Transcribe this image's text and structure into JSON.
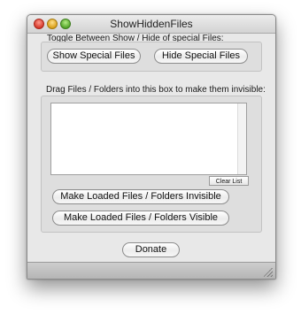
{
  "window": {
    "title": "ShowHiddenFiles"
  },
  "toggle_section": {
    "label": "Toggle Between Show / Hide of special Files:",
    "show_button": "Show Special Files",
    "hide_button": "Hide Special Files"
  },
  "drop_section": {
    "label": "Drag Files / Folders into this box to make them invisible:",
    "clear_button": "Clear List",
    "invisible_button": "Make Loaded Files / Folders Invisible",
    "visible_button": "Make Loaded Files / Folders Visible"
  },
  "footer": {
    "donate_button": "Donate"
  }
}
